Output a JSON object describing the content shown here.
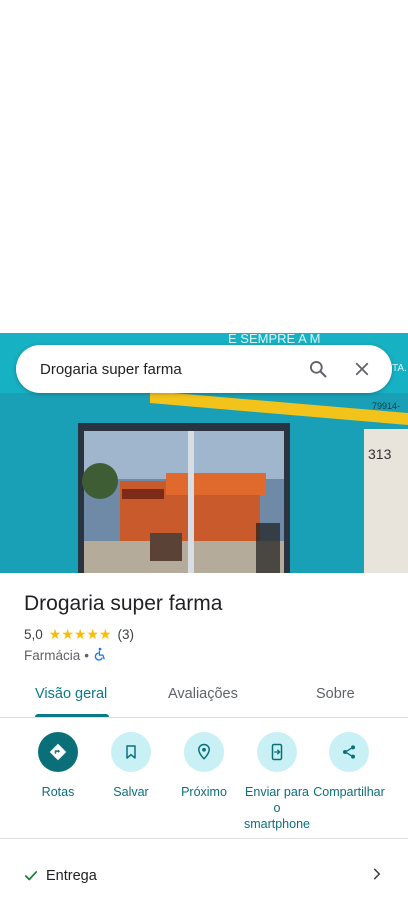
{
  "search": {
    "query": "Drogaria super farma"
  },
  "photo": {
    "storefront_number": "313",
    "sign_text_top": "E SEMPRE A M",
    "sign_text_phone": "79914-",
    "sign_text_right": "TA."
  },
  "place": {
    "name": "Drogaria super farma",
    "rating": "5,0",
    "stars": "★★★★★",
    "review_count": "(3)",
    "category": "Farmácia",
    "separator": "•",
    "accessibility_icon": "wheelchair-icon"
  },
  "tabs": [
    {
      "label": "Visão geral",
      "active": true
    },
    {
      "label": "Avaliações",
      "active": false
    },
    {
      "label": "Sobre",
      "active": false
    }
  ],
  "actions": [
    {
      "label": "Rotas",
      "icon": "directions-icon"
    },
    {
      "label": "Salvar",
      "icon": "bookmark-icon"
    },
    {
      "label": "Próximo",
      "icon": "nearby-icon"
    },
    {
      "label": "Enviar para o smartphone",
      "icon": "send-to-phone-icon"
    },
    {
      "label": "Compartilhar",
      "icon": "share-icon"
    }
  ],
  "info_rows": [
    {
      "label": "Entrega",
      "icon": "check-icon"
    }
  ],
  "colors": {
    "accent": "#0b6f7a",
    "action_bg": "#c8f0f5",
    "star": "#fbbc04",
    "wall": "#1d9fb4"
  }
}
